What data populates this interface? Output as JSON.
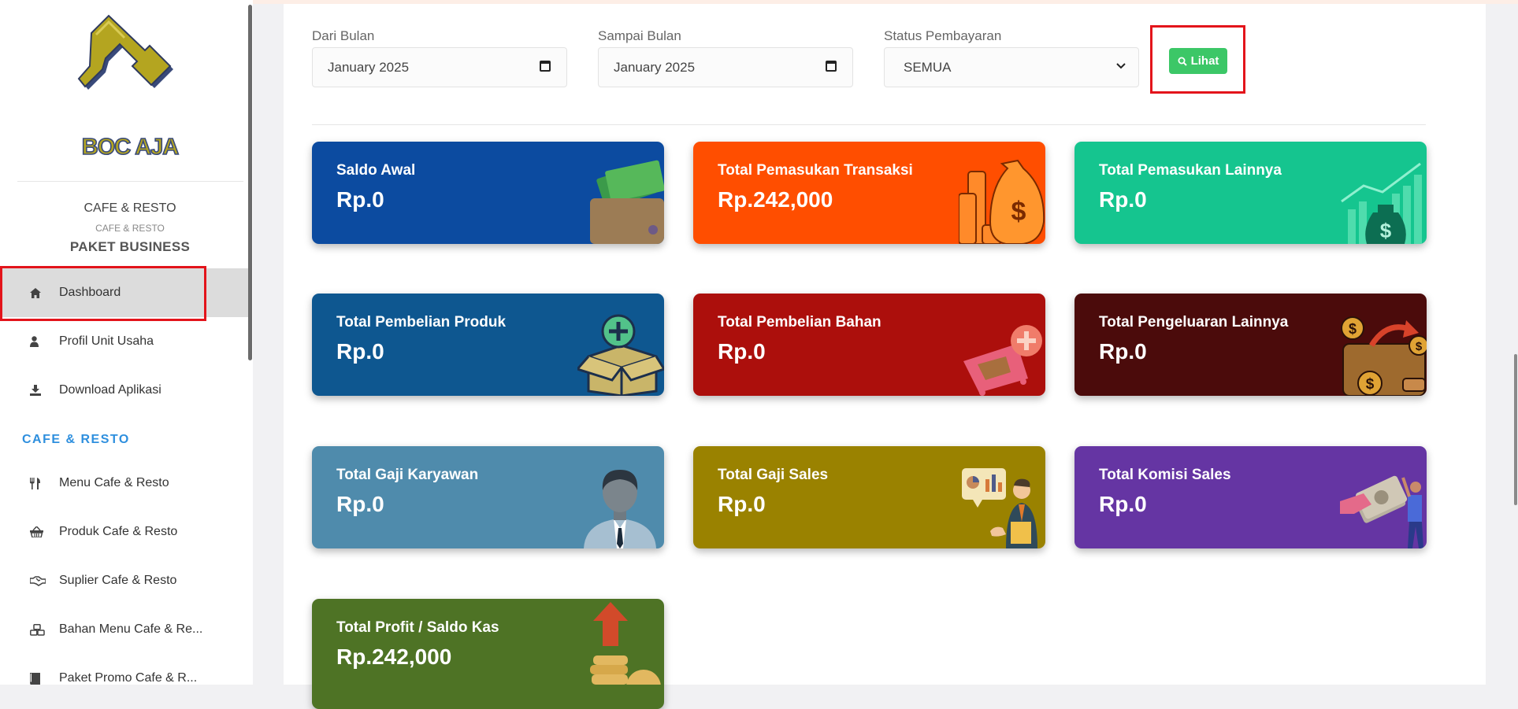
{
  "sidebar": {
    "logo_text": "BOC AJA",
    "brand_title": "CAFE & RESTO",
    "brand_subtitle": "CAFE & RESTO",
    "package": "PAKET BUSINESS",
    "nav": [
      {
        "label": "Dashboard",
        "icon": "home-icon",
        "active": true
      },
      {
        "label": "Profil Unit Usaha",
        "icon": "user-icon"
      },
      {
        "label": "Download Aplikasi",
        "icon": "download-icon"
      }
    ],
    "section_title": "CAFE & RESTO",
    "section_items": [
      {
        "label": "Menu Cafe & Resto",
        "icon": "cutlery-icon"
      },
      {
        "label": "Produk Cafe & Resto",
        "icon": "basket-icon"
      },
      {
        "label": "Suplier Cafe & Resto",
        "icon": "handshake-icon"
      },
      {
        "label": "Bahan Menu Cafe & Re...",
        "icon": "cubes-icon"
      },
      {
        "label": "Paket Promo Cafe & R...",
        "icon": "book-icon"
      }
    ]
  },
  "filters": {
    "from_label": "Dari Bulan",
    "from_value": "January 2025",
    "to_label": "Sampai Bulan",
    "to_value": "January 2025",
    "status_label": "Status Pembayaran",
    "status_value": "SEMUA",
    "button_label": "Lihat"
  },
  "cards": [
    {
      "title": "Saldo Awal",
      "value": "Rp.0",
      "color": "#0c4ba0",
      "icon": "wallet-icon"
    },
    {
      "title": "Total Pemasukan Transaksi",
      "value": "Rp.242,000",
      "color": "#ff4e00",
      "icon": "money-bag-icon"
    },
    {
      "title": "Total Pemasukan Lainnya",
      "value": "Rp.0",
      "color": "#15c58f",
      "icon": "growth-chart-icon"
    },
    {
      "title": "Total Pembelian Produk",
      "value": "Rp.0",
      "color": "#0e5790",
      "icon": "box-add-icon"
    },
    {
      "title": "Total Pembelian Bahan",
      "value": "Rp.0",
      "color": "#ac0f0c",
      "icon": "cart-add-icon"
    },
    {
      "title": "Total Pengeluaran Lainnya",
      "value": "Rp.0",
      "color": "#4b0b0b",
      "icon": "wallet-out-icon"
    },
    {
      "title": "Total Gaji Karyawan",
      "value": "Rp.0",
      "color": "#4f8bac",
      "icon": "employee-icon"
    },
    {
      "title": "Total Gaji Sales",
      "value": "Rp.0",
      "color": "#9a8200",
      "icon": "salesman-icon"
    },
    {
      "title": "Total Komisi Sales",
      "value": "Rp.0",
      "color": "#6535a3",
      "icon": "commission-icon"
    },
    {
      "title": "Total Profit / Saldo Kas",
      "value": "Rp.242,000",
      "color": "#4e7325",
      "icon": "profit-icon"
    }
  ]
}
